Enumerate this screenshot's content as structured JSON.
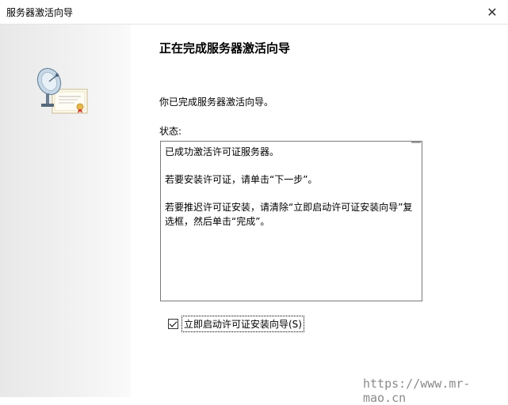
{
  "window": {
    "title": "服务器激活向导",
    "close_glyph": "✕"
  },
  "page": {
    "heading": "正在完成服务器激活向导",
    "completed_message": "你已完成服务器激活向导。",
    "status_label": "状态:",
    "status_lines": [
      "已成功激活许可证服务器。",
      "若要安装许可证，请单击“下一步”。",
      "若要推迟许可证安装，请清除“立即启动许可证安装向导”复选框，然后单击“完成”。"
    ]
  },
  "checkbox": {
    "label": "立即启动许可证安装向导(S)",
    "checked": true
  },
  "watermark": "https://www.mr-mao.cn",
  "icons": {
    "wizard": "satellite-dish-certificate-icon",
    "close": "close-icon"
  }
}
